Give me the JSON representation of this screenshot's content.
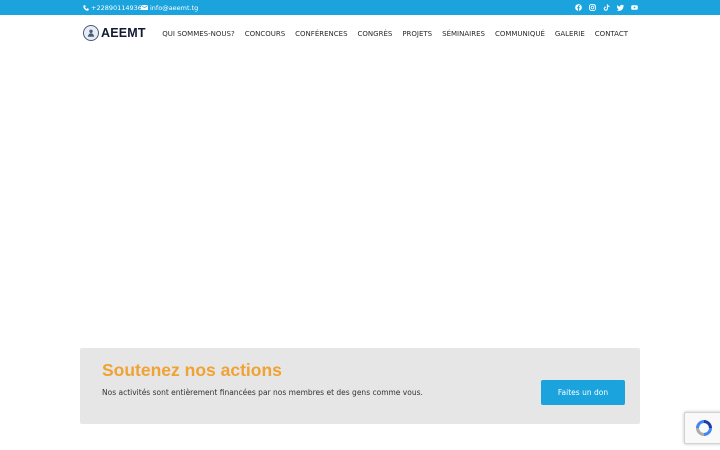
{
  "topbar": {
    "phone": "+22890114936",
    "email": "info@aeemt.tg",
    "socials": [
      "facebook-icon",
      "instagram-icon",
      "tiktok-icon",
      "twitter-icon",
      "youtube-icon"
    ]
  },
  "header": {
    "logo_text": "AEEMT",
    "nav": [
      "QUI SOMMES-NOUS?",
      "CONCOURS",
      "CONFÉRENCES",
      "CONGRÈS",
      "PROJETS",
      "SÉMINAIRES",
      "COMMUNIQUÉ",
      "GALERIE",
      "CONTACT"
    ]
  },
  "support": {
    "title": "Soutenez nos actions",
    "text": "Nos activités sont entièrement financées par nos membres et des gens comme vous.",
    "button": "Faites un don"
  },
  "colors": {
    "brand_blue": "#1aa3dc",
    "accent_orange": "#f0a233",
    "panel_gray": "#e6e6e6"
  }
}
